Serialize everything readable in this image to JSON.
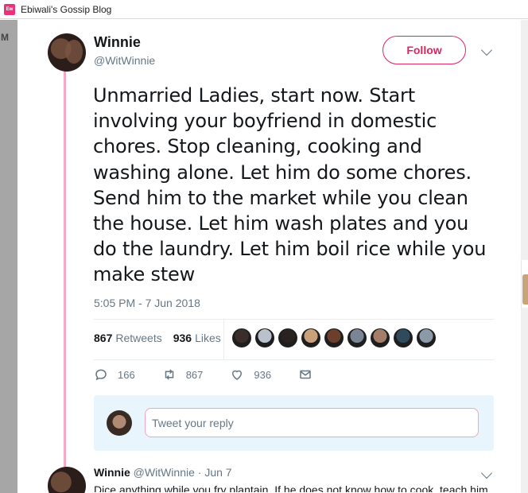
{
  "window": {
    "title": "Ebiwali's Gossip Blog",
    "favicon_text": "Ew"
  },
  "background": {
    "tab_label": "M"
  },
  "tweet": {
    "author_name": "Winnie",
    "author_handle": "@WitWinnie",
    "follow_label": "Follow",
    "text": "Unmarried Ladies, start now. Start involving your boyfriend in domestic chores. Stop cleaning, cooking and washing alone. Let him do some chores. Send him to the market while you clean the house. Let him wash plates and you do the laundry. Let him boil rice while you make stew",
    "timestamp": "5:05 PM - 7 Jun 2018",
    "retweets_count": "867",
    "retweets_label": "Retweets",
    "likes_count": "936",
    "likes_label": "Likes",
    "liker_avatars": [
      "#3b2e2a",
      "#b9c2cc",
      "#2a2220",
      "#c9a07a",
      "#6b3f2c",
      "#7a8596",
      "#a37c6a",
      "#2f4a5c",
      "#8a9aa8"
    ],
    "reply_count": "166",
    "retweet_count": "867",
    "like_count": "936",
    "reply_placeholder": "Tweet your reply"
  },
  "next_tweet": {
    "author_name": "Winnie",
    "meta": "@WitWinnie · Jun 7",
    "text": "Dice anything while you fry plantain. If he does not know how to cook, teach him."
  },
  "colors": {
    "accent": "#e0245e",
    "thread_line": "#f6a8c4",
    "muted": "#657786"
  },
  "icons": [
    "reply-icon",
    "retweet-icon",
    "like-icon",
    "message-icon",
    "chevron-down-icon"
  ]
}
